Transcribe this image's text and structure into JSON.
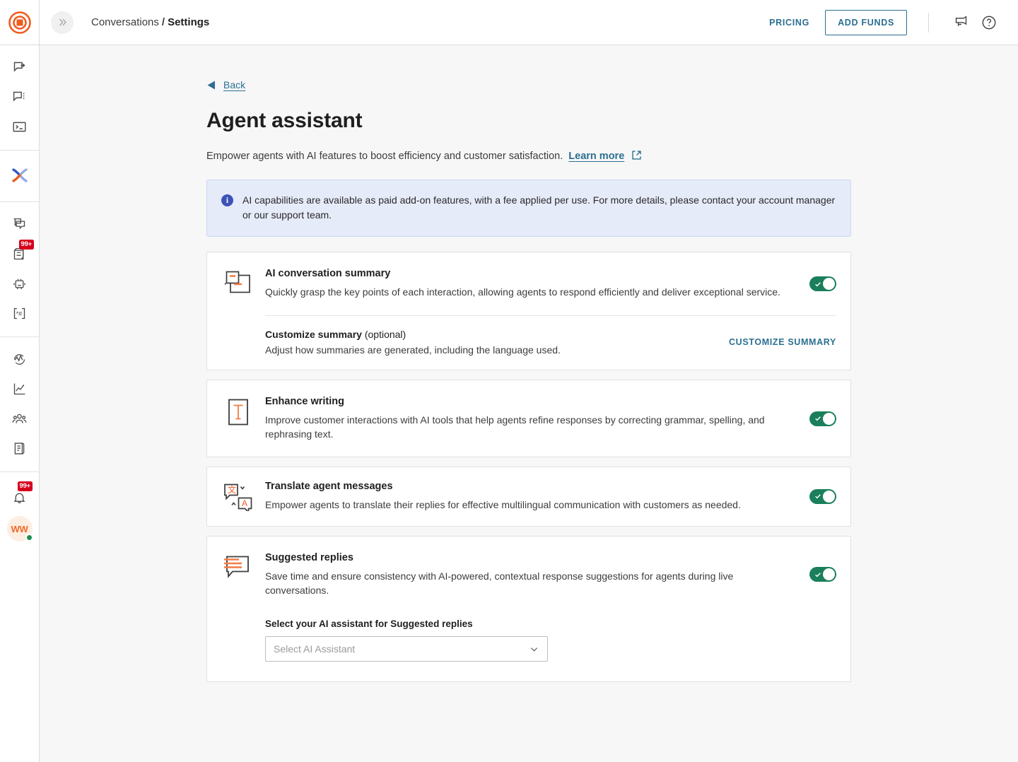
{
  "brand": {
    "logo_icon": "target-logo-icon",
    "accent_orange": "#ef5a1f",
    "accent_teal": "#2b6f91",
    "toggle_on_color": "#1a7f5a"
  },
  "sidebar": {
    "groups": [
      {
        "items": [
          {
            "icon": "chat-forward-icon",
            "name": "sidebar-item-chat-forward"
          },
          {
            "icon": "chat-menu-icon",
            "name": "sidebar-item-chat-menu"
          },
          {
            "icon": "terminal-icon",
            "name": "sidebar-item-terminal"
          }
        ]
      },
      {
        "items": [
          {
            "icon": "x-flow-icon",
            "name": "sidebar-item-flows",
            "active": true
          }
        ]
      },
      {
        "items": [
          {
            "icon": "copy-chat-icon",
            "name": "sidebar-item-canned-responses"
          },
          {
            "icon": "archive-icon",
            "name": "sidebar-item-archive",
            "badge": "99+"
          },
          {
            "icon": "robot-icon",
            "name": "sidebar-item-bots"
          },
          {
            "icon": "variables-icon",
            "name": "sidebar-item-variables"
          }
        ]
      },
      {
        "items": [
          {
            "icon": "pulse-icon",
            "name": "sidebar-item-monitoring"
          },
          {
            "icon": "chart-line-icon",
            "name": "sidebar-item-reports"
          },
          {
            "icon": "team-icon",
            "name": "sidebar-item-team"
          },
          {
            "icon": "book-icon",
            "name": "sidebar-item-knowledge-base"
          }
        ]
      },
      {
        "items": [
          {
            "icon": "bell-icon",
            "name": "sidebar-item-notifications",
            "badge": "99+"
          }
        ]
      }
    ],
    "avatar_initials": "WW"
  },
  "topbar": {
    "collapse_icon": "double-chevron-right-icon",
    "breadcrumb_parent": "Conversations",
    "breadcrumb_separator": "/",
    "breadcrumb_current": "Settings",
    "pricing_label": "PRICING",
    "add_funds_label": "ADD FUNDS",
    "announcement_icon": "megaphone-icon",
    "help_icon": "question-circle-icon"
  },
  "page": {
    "back_label": "Back",
    "back_icon": "caret-left-icon",
    "title": "Agent assistant",
    "subtitle": "Empower agents with AI features to boost efficiency and customer satisfaction.",
    "learn_more_label": "Learn more",
    "external_link_icon": "external-link-icon",
    "banner": {
      "icon": "info-icon",
      "glyph": "i",
      "text": "AI capabilities are available as paid add-on features, with a fee applied per use. For more details, please contact your account manager or our support team."
    },
    "cards": [
      {
        "id": "ai-conversation-summary",
        "icon": "summary-document-icon",
        "title": "AI conversation summary",
        "description": "Quickly grasp the key points of each interaction, allowing agents to respond efficiently and deliver exceptional service.",
        "toggle_on": true,
        "sub": {
          "title_strong": "Customize summary",
          "title_optional": "(optional)",
          "description": "Adjust how summaries are generated, including the language used.",
          "action_label": "CUSTOMIZE SUMMARY"
        }
      },
      {
        "id": "enhance-writing",
        "icon": "text-cursor-icon",
        "title": "Enhance writing",
        "description": "Improve customer interactions with AI tools that help agents refine responses by correcting grammar, spelling, and rephrasing text.",
        "toggle_on": true
      },
      {
        "id": "translate-agent-messages",
        "icon": "translate-icon",
        "title": "Translate agent messages",
        "description": "Empower agents to translate their replies for effective multilingual communication with customers as needed.",
        "toggle_on": true
      },
      {
        "id": "suggested-replies",
        "icon": "suggested-replies-icon",
        "title": "Suggested replies",
        "description": "Save time and ensure consistency with AI-powered, contextual response suggestions for agents during live conversations.",
        "toggle_on": true,
        "field": {
          "label": "Select your AI assistant for Suggested replies",
          "placeholder": "Select AI Assistant",
          "value": "",
          "caret_icon": "chevron-down-icon"
        }
      }
    ]
  }
}
